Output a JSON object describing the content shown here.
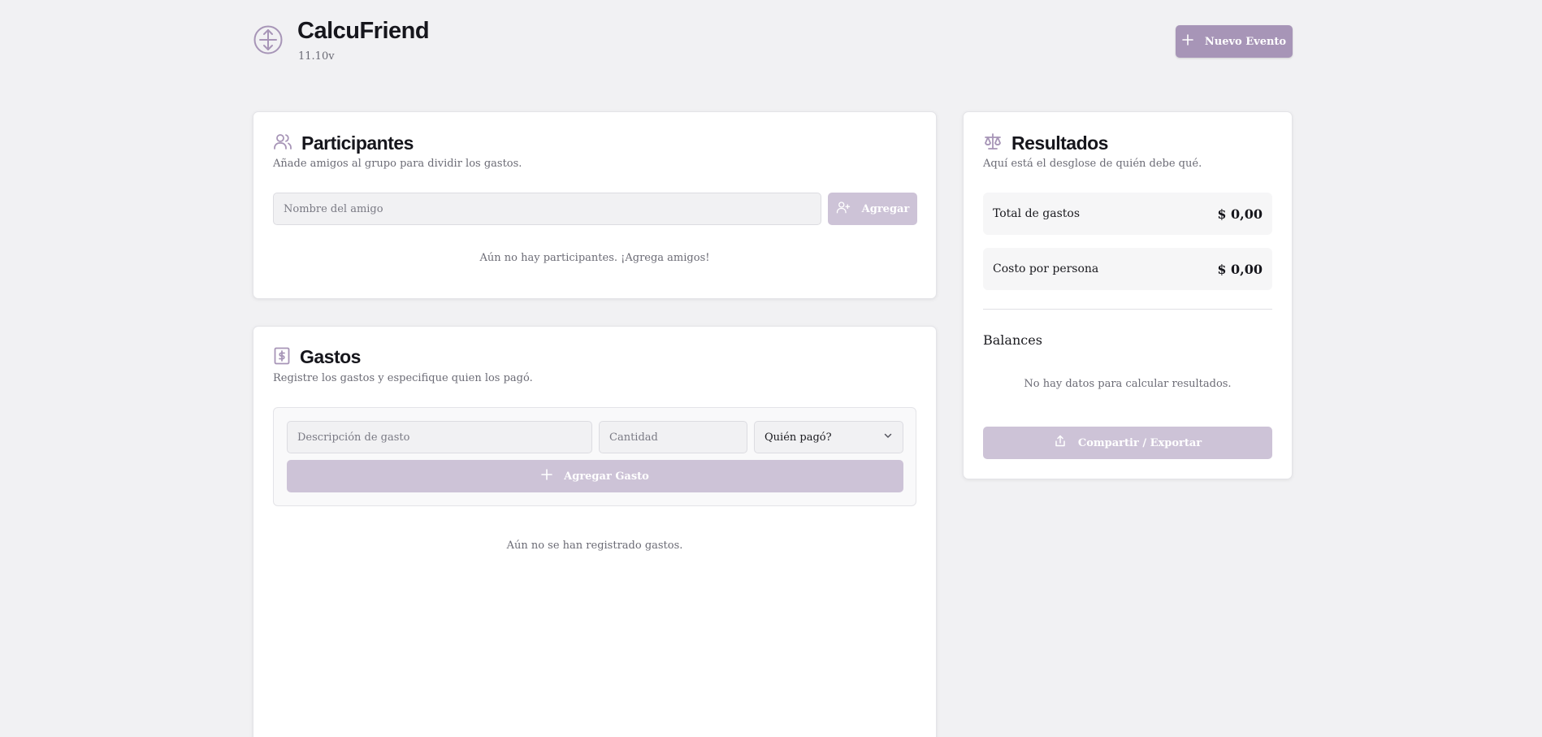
{
  "app": {
    "title": "CalcuFriend",
    "version": "11.10v",
    "new_event_label": "Nuevo Evento"
  },
  "participants": {
    "title": "Participantes",
    "subtitle": "Añade amigos al grupo para dividir los gastos.",
    "input_placeholder": "Nombre del amigo",
    "add_label": "Agregar",
    "empty_text": "Aún no hay participantes. ¡Agrega amigos!"
  },
  "expenses": {
    "title": "Gastos",
    "subtitle": "Registre los gastos y especifique quien los pagó.",
    "description_placeholder": "Descripción de gasto",
    "amount_placeholder": "Cantidad",
    "payer_select": "Quién pagó?",
    "add_label": "Agregar Gasto",
    "empty_text": "Aún no se han registrado gastos."
  },
  "results": {
    "title": "Resultados",
    "subtitle": "Aquí está el desglose de quién debe qué.",
    "total_label": "Total de gastos",
    "total_value": "$ 0,00",
    "per_person_label": "Costo por persona",
    "per_person_value": "$ 0,00",
    "balances_title": "Balances",
    "empty_text": "No hay datos para calcular resultados.",
    "share_label": "Compartir / Exportar"
  },
  "colors": {
    "accent": "#a795b7",
    "accent_disabled": "#cdc3d7",
    "background": "#f1f1f3"
  },
  "icons": {
    "logo": "scale-circle-icon",
    "new_event": "plus-icon",
    "participants": "users-icon",
    "add_participant": "user-plus-icon",
    "expenses": "receipt-dollar-icon",
    "add_expense": "plus-icon",
    "payer_dropdown": "chevron-down-icon",
    "results": "scale-icon",
    "share": "share-icon"
  }
}
